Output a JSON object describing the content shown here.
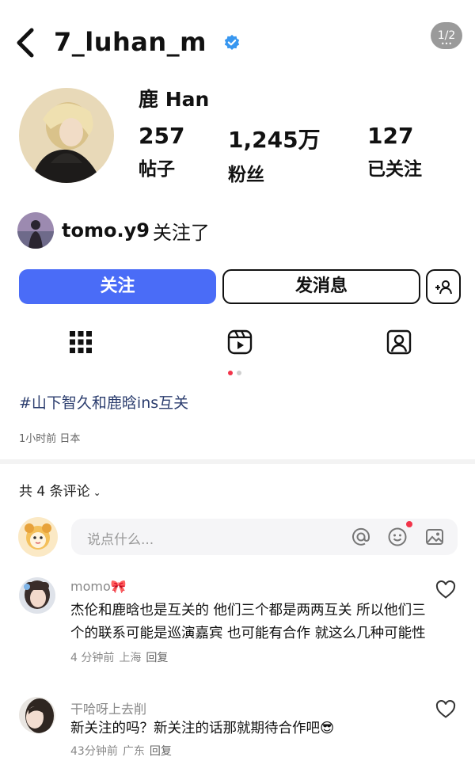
{
  "profile": {
    "username": "7_luhan_m",
    "display_name": "鹿 Han",
    "page_indicator": "1/2",
    "stats": [
      {
        "value": "257",
        "label": "帖子"
      },
      {
        "value": "1,245万",
        "label": "粉丝"
      },
      {
        "value": "127",
        "label": "已关注"
      }
    ],
    "followed_by_user": "tomo.y9",
    "followed_by_suffix": "关注了",
    "follow_label": "关注",
    "message_label": "发消息"
  },
  "post": {
    "hashtag_text": "#山下智久和鹿晗ins互关",
    "time": "1小时前",
    "location": "日本",
    "carousel_active_index": 0,
    "carousel_count": 2
  },
  "comments_section": {
    "count_label": "共 4 条评论",
    "input_placeholder": "说点什么...",
    "comments": [
      {
        "user": "momo🎀",
        "text": "杰伦和鹿晗也是互关的 他们三个都是两两互关 所以他们三个的联系可能是巡演嘉宾 也可能有合作 就这么几种可能性",
        "time": "4 分钟前",
        "location": "上海",
        "reply": "回复"
      },
      {
        "user": "干哈呀上去削",
        "text": "新关注的吗？新关注的话那就期待合作吧😎",
        "time": "43分钟前",
        "location": "广东",
        "reply": "回复"
      }
    ]
  },
  "colors": {
    "accent_blue": "#4a6cf7",
    "verified_blue": "#3897f0",
    "notification_red": "#f2344a",
    "hashtag_color": "#2b3d6e"
  }
}
